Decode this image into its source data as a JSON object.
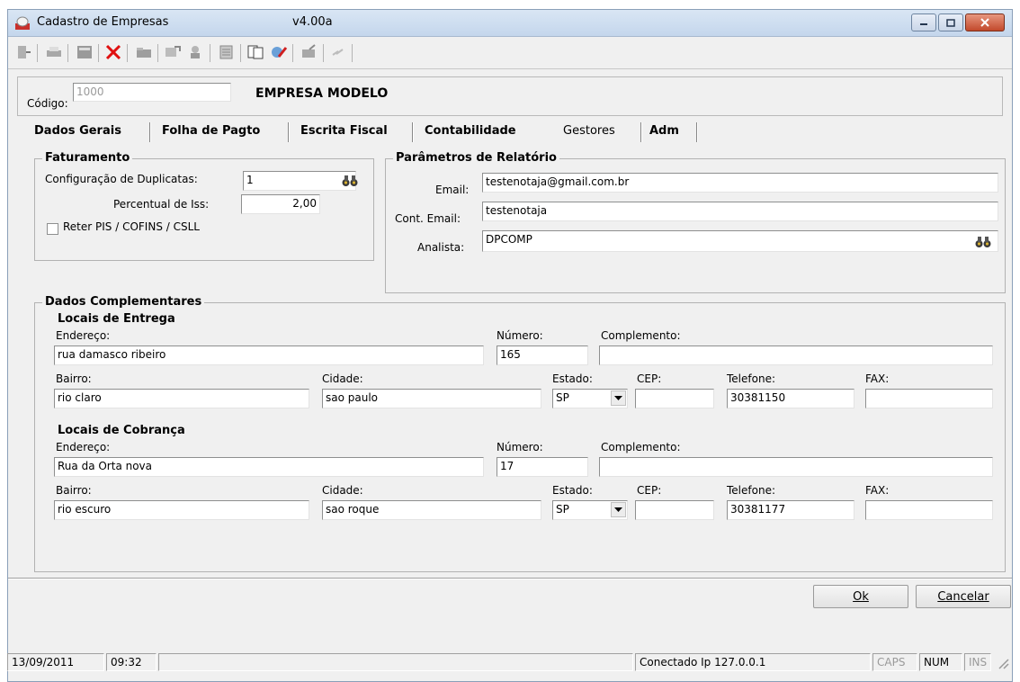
{
  "window": {
    "title": "Cadastro de Empresas",
    "version": "v4.00a",
    "controls": [
      "minimize",
      "maximize",
      "close"
    ]
  },
  "toolbar": {
    "icons": [
      "exit-icon",
      "print-icon",
      "calculator-icon",
      "delete-icon",
      "folder-icon",
      "import-icon",
      "user-search-icon",
      "report-icon",
      "copy-icon",
      "edit-icon",
      "config-icon",
      "lightning-icon"
    ]
  },
  "header": {
    "codigo_label": "Código:",
    "codigo_value": "1000",
    "company_name": "EMPRESA MODELO"
  },
  "tabs": [
    {
      "label": "Dados Gerais",
      "active": false
    },
    {
      "label": "Folha de Pagto",
      "active": false
    },
    {
      "label": "Escrita Fiscal",
      "active": false
    },
    {
      "label": "Contabilidade",
      "active": false
    },
    {
      "label": "Gestores",
      "active": true
    },
    {
      "label": "Adm",
      "active": false
    }
  ],
  "faturamento": {
    "title": "Faturamento",
    "config_label": "Configuração de Duplicatas:",
    "config_value": "1",
    "iss_label": "Percentual de Iss:",
    "iss_value": "2,00",
    "reter_label": "Reter PIS / COFINS / CSLL",
    "reter_checked": false
  },
  "parametros": {
    "title": "Parâmetros de Relatório",
    "email_label": "Email:",
    "email_value": "testenotaja@gmail.com.br",
    "cont_email_label": "Cont. Email:",
    "cont_email_value": "testenotaja",
    "analista_label": "Analista:",
    "analista_value": "DPCOMP"
  },
  "complementares": {
    "title": "Dados Complementares",
    "entrega": {
      "title": "Locais de Entrega",
      "endereco_label": "Endereço:",
      "endereco": "rua damasco ribeiro",
      "numero_label": "Número:",
      "numero": "165",
      "complemento_label": "Complemento:",
      "complemento": "",
      "bairro_label": "Bairro:",
      "bairro": "rio claro",
      "cidade_label": "Cidade:",
      "cidade": "sao paulo",
      "estado_label": "Estado:",
      "estado": "SP",
      "cep_label": "CEP:",
      "cep": "",
      "telefone_label": "Telefone:",
      "telefone": "30381150",
      "fax_label": "FAX:",
      "fax": ""
    },
    "cobranca": {
      "title": "Locais de Cobrança",
      "endereco_label": "Endereço:",
      "endereco": "Rua da Orta nova",
      "numero_label": "Número:",
      "numero": "17",
      "complemento_label": "Complemento:",
      "complemento": "",
      "bairro_label": "Bairro:",
      "bairro": "rio escuro",
      "cidade_label": "Cidade:",
      "cidade": "sao roque",
      "estado_label": "Estado:",
      "estado": "SP",
      "cep_label": "CEP:",
      "cep": "",
      "telefone_label": "Telefone:",
      "telefone": "30381177",
      "fax_label": "FAX:",
      "fax": ""
    }
  },
  "buttons": {
    "ok": "Ok",
    "cancelar": "Cancelar"
  },
  "statusbar": {
    "date": "13/09/2011",
    "time": "09:32",
    "connection": "Conectado Ip 127.0.0.1",
    "caps": "CAPS",
    "num": "NUM",
    "ins": "INS"
  }
}
